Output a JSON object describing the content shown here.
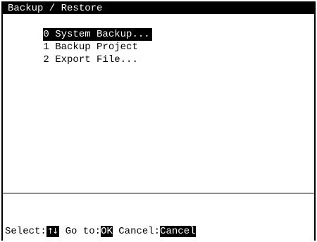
{
  "title": "Backup / Restore",
  "menu": {
    "items": [
      {
        "label": "0 System Backup...",
        "selected": true
      },
      {
        "label": "1 Backup Project",
        "selected": false
      },
      {
        "label": "2 Export File...",
        "selected": false
      }
    ]
  },
  "status": {
    "select_label": "Select:",
    "select_key": "↑↓",
    "goto_label": " Go to:",
    "goto_key": "OK",
    "cancel_label": " Cancel:",
    "cancel_key": "Cancel"
  },
  "colors": {
    "background": "#ffffff",
    "foreground": "#000000",
    "highlight": "#000000"
  }
}
